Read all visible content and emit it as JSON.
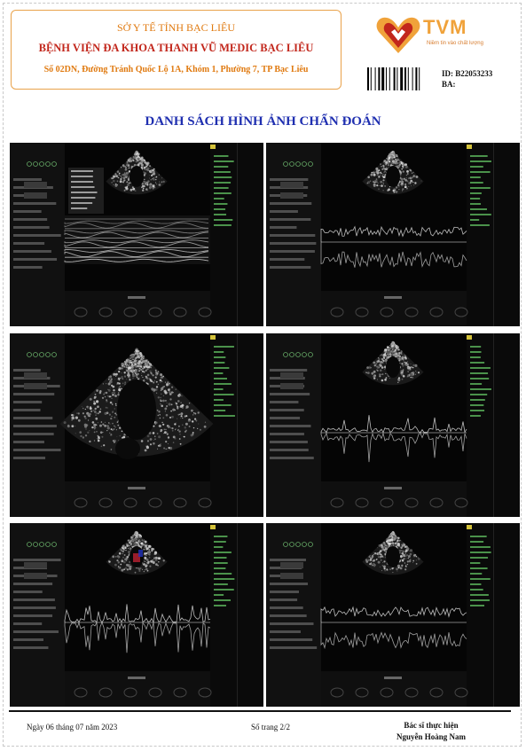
{
  "header": {
    "line1": "SỞ Y TẾ TỈNH BẠC LIÊU",
    "line2": "BỆNH VIỆN ĐA KHOA THANH VŨ MEDIC BẠC LIÊU",
    "line3": "Số 02DN, Đường Tránh Quốc Lộ 1A, Khóm 1, Phường 7, TP Bạc Liêu"
  },
  "logo": {
    "text": "TVM",
    "slogan": "Niềm tin vào chất lượng",
    "brand_color": "#f0a23a"
  },
  "record": {
    "id": "ID: B22053233",
    "ba": "BA:"
  },
  "title": "DANH SÁCH HÌNH ẢNH CHẨN ĐOÁN",
  "images": [
    {
      "name": "echo-image-1",
      "mode": "m-mode"
    },
    {
      "name": "echo-image-2",
      "mode": "doppler"
    },
    {
      "name": "echo-image-3",
      "mode": "2d"
    },
    {
      "name": "echo-image-4",
      "mode": "doppler"
    },
    {
      "name": "echo-image-5",
      "mode": "doppler"
    },
    {
      "name": "echo-image-6",
      "mode": "doppler"
    }
  ],
  "footer": {
    "date": "Ngày 06 tháng 07 năm 2023",
    "page": "Số trang 2/2",
    "role": "Bác sĩ thực hiện",
    "doctor": "Nguyễn Hoàng Nam"
  }
}
